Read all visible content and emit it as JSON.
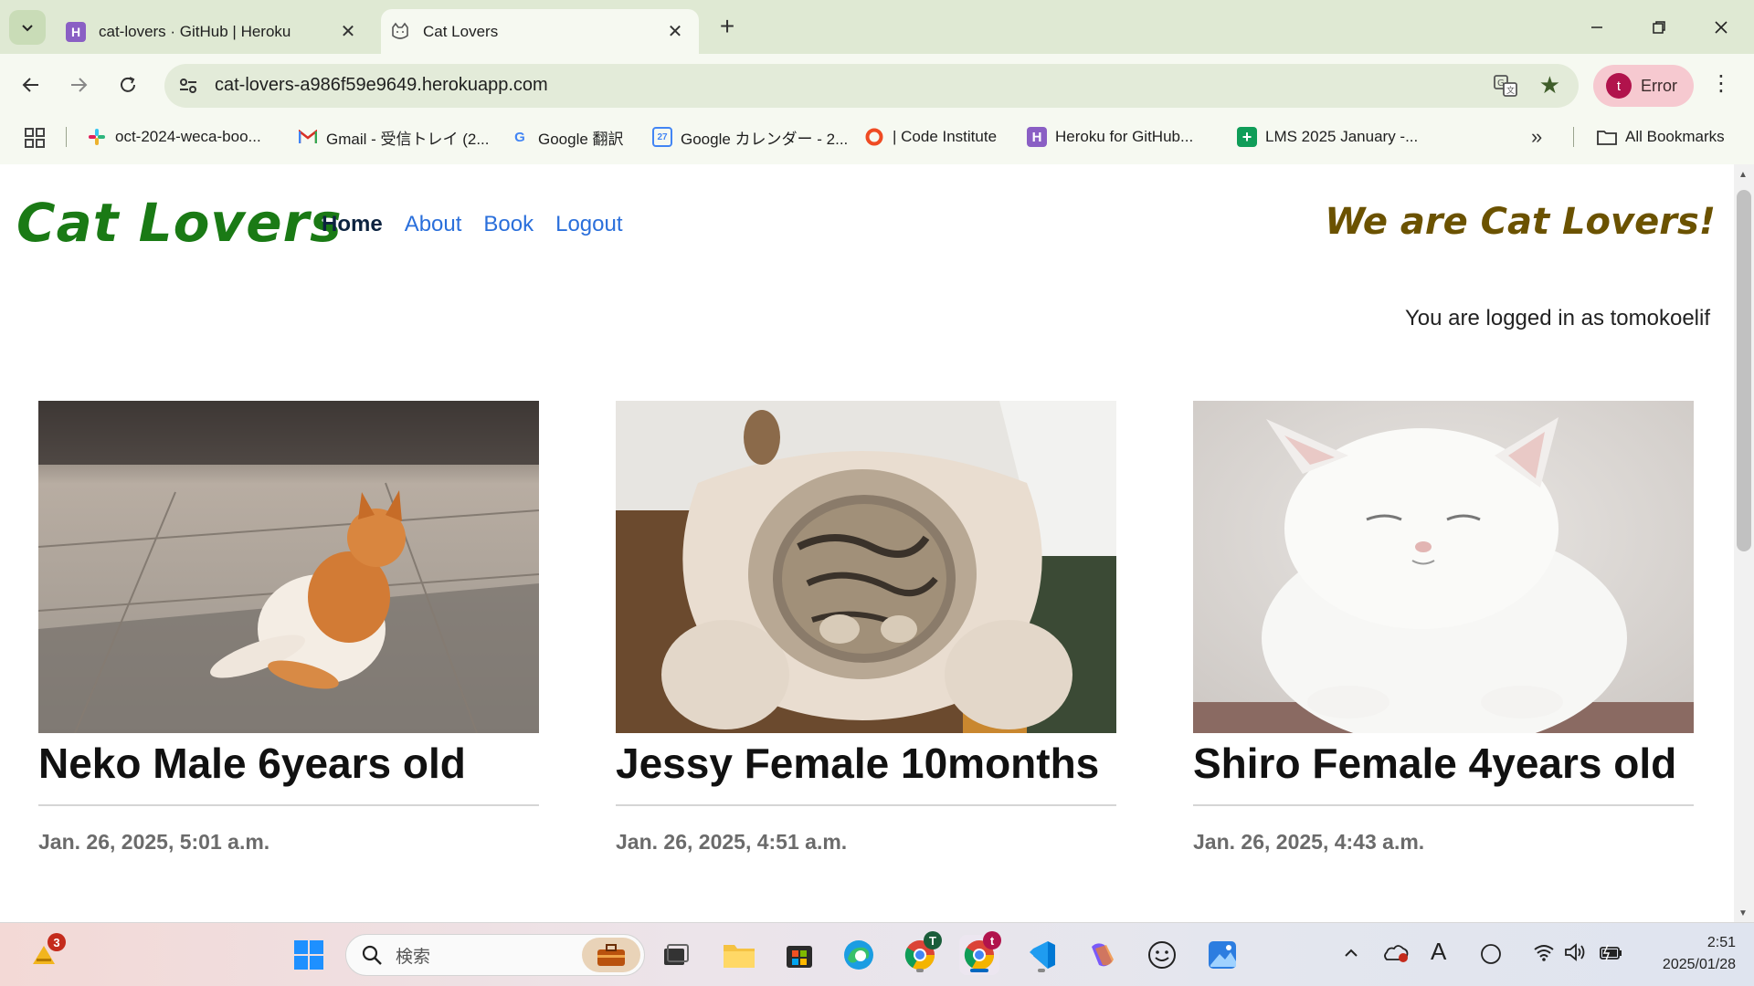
{
  "browser": {
    "tabs": [
      {
        "title": "cat-lovers · GitHub | Heroku",
        "active": false,
        "favicon": "heroku-icon"
      },
      {
        "title": "Cat Lovers",
        "active": true,
        "favicon": "cat-icon"
      }
    ],
    "url": "cat-lovers-a986f59e9649.herokuapp.com",
    "profile_initial": "t",
    "profile_label": "Error",
    "bookmarks": [
      {
        "label": "oct-2024-weca-boo...",
        "icon": "slack-icon"
      },
      {
        "label": "Gmail - 受信トレイ (2...",
        "icon": "gmail-icon"
      },
      {
        "label": "Google 翻訳",
        "icon": "google-icon"
      },
      {
        "label": "Google カレンダー - 2...",
        "icon": "calendar-icon"
      },
      {
        "label": "| Code Institute",
        "icon": "code-institute-icon"
      },
      {
        "label": "Heroku for GitHub...",
        "icon": "heroku-icon"
      },
      {
        "label": "LMS 2025 January -...",
        "icon": "sheets-icon"
      }
    ],
    "all_bookmarks": "All Bookmarks",
    "calendar_day": "27"
  },
  "site": {
    "brand": "Cat Lovers",
    "nav": [
      {
        "label": "Home",
        "active": true
      },
      {
        "label": "About",
        "active": false
      },
      {
        "label": "Book",
        "active": false
      },
      {
        "label": "Logout",
        "active": false
      }
    ],
    "tagline": "We are Cat Lovers!",
    "login_status": "You are logged in as tomokoelif"
  },
  "posts": [
    {
      "title": "Neko Male 6years old",
      "date": "Jan. 26, 2025, 5:01 a.m."
    },
    {
      "title": "Jessy Female 10months",
      "date": "Jan. 26, 2025, 4:51 a.m."
    },
    {
      "title": "Shiro Female 4years old",
      "date": "Jan. 26, 2025, 4:43 a.m."
    }
  ],
  "taskbar": {
    "notification_count": "3",
    "search_placeholder": "検索",
    "chrome_badge_1": "T",
    "chrome_badge_2": "t",
    "time": "2:51",
    "date": "2025/01/28",
    "ime": "A"
  },
  "colors": {
    "brand": "#1a7a15",
    "tagline": "#6b5200",
    "link": "#2a6fdb",
    "chrome_bg": "#dfe9d3"
  }
}
